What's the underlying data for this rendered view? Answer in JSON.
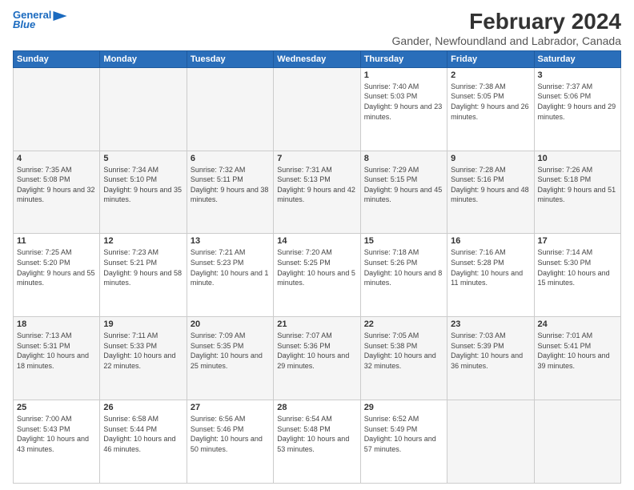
{
  "header": {
    "logo_line1": "General",
    "logo_line2": "Blue",
    "title": "February 2024",
    "subtitle": "Gander, Newfoundland and Labrador, Canada"
  },
  "weekdays": [
    "Sunday",
    "Monday",
    "Tuesday",
    "Wednesday",
    "Thursday",
    "Friday",
    "Saturday"
  ],
  "weeks": [
    [
      {
        "day": "",
        "empty": true
      },
      {
        "day": "",
        "empty": true
      },
      {
        "day": "",
        "empty": true
      },
      {
        "day": "",
        "empty": true
      },
      {
        "day": "1",
        "sunrise": "7:40 AM",
        "sunset": "5:03 PM",
        "daylight": "9 hours and 23 minutes."
      },
      {
        "day": "2",
        "sunrise": "7:38 AM",
        "sunset": "5:05 PM",
        "daylight": "9 hours and 26 minutes."
      },
      {
        "day": "3",
        "sunrise": "7:37 AM",
        "sunset": "5:06 PM",
        "daylight": "9 hours and 29 minutes."
      }
    ],
    [
      {
        "day": "4",
        "sunrise": "7:35 AM",
        "sunset": "5:08 PM",
        "daylight": "9 hours and 32 minutes."
      },
      {
        "day": "5",
        "sunrise": "7:34 AM",
        "sunset": "5:10 PM",
        "daylight": "9 hours and 35 minutes."
      },
      {
        "day": "6",
        "sunrise": "7:32 AM",
        "sunset": "5:11 PM",
        "daylight": "9 hours and 38 minutes."
      },
      {
        "day": "7",
        "sunrise": "7:31 AM",
        "sunset": "5:13 PM",
        "daylight": "9 hours and 42 minutes."
      },
      {
        "day": "8",
        "sunrise": "7:29 AM",
        "sunset": "5:15 PM",
        "daylight": "9 hours and 45 minutes."
      },
      {
        "day": "9",
        "sunrise": "7:28 AM",
        "sunset": "5:16 PM",
        "daylight": "9 hours and 48 minutes."
      },
      {
        "day": "10",
        "sunrise": "7:26 AM",
        "sunset": "5:18 PM",
        "daylight": "9 hours and 51 minutes."
      }
    ],
    [
      {
        "day": "11",
        "sunrise": "7:25 AM",
        "sunset": "5:20 PM",
        "daylight": "9 hours and 55 minutes."
      },
      {
        "day": "12",
        "sunrise": "7:23 AM",
        "sunset": "5:21 PM",
        "daylight": "9 hours and 58 minutes."
      },
      {
        "day": "13",
        "sunrise": "7:21 AM",
        "sunset": "5:23 PM",
        "daylight": "10 hours and 1 minute."
      },
      {
        "day": "14",
        "sunrise": "7:20 AM",
        "sunset": "5:25 PM",
        "daylight": "10 hours and 5 minutes."
      },
      {
        "day": "15",
        "sunrise": "7:18 AM",
        "sunset": "5:26 PM",
        "daylight": "10 hours and 8 minutes."
      },
      {
        "day": "16",
        "sunrise": "7:16 AM",
        "sunset": "5:28 PM",
        "daylight": "10 hours and 11 minutes."
      },
      {
        "day": "17",
        "sunrise": "7:14 AM",
        "sunset": "5:30 PM",
        "daylight": "10 hours and 15 minutes."
      }
    ],
    [
      {
        "day": "18",
        "sunrise": "7:13 AM",
        "sunset": "5:31 PM",
        "daylight": "10 hours and 18 minutes."
      },
      {
        "day": "19",
        "sunrise": "7:11 AM",
        "sunset": "5:33 PM",
        "daylight": "10 hours and 22 minutes."
      },
      {
        "day": "20",
        "sunrise": "7:09 AM",
        "sunset": "5:35 PM",
        "daylight": "10 hours and 25 minutes."
      },
      {
        "day": "21",
        "sunrise": "7:07 AM",
        "sunset": "5:36 PM",
        "daylight": "10 hours and 29 minutes."
      },
      {
        "day": "22",
        "sunrise": "7:05 AM",
        "sunset": "5:38 PM",
        "daylight": "10 hours and 32 minutes."
      },
      {
        "day": "23",
        "sunrise": "7:03 AM",
        "sunset": "5:39 PM",
        "daylight": "10 hours and 36 minutes."
      },
      {
        "day": "24",
        "sunrise": "7:01 AM",
        "sunset": "5:41 PM",
        "daylight": "10 hours and 39 minutes."
      }
    ],
    [
      {
        "day": "25",
        "sunrise": "7:00 AM",
        "sunset": "5:43 PM",
        "daylight": "10 hours and 43 minutes."
      },
      {
        "day": "26",
        "sunrise": "6:58 AM",
        "sunset": "5:44 PM",
        "daylight": "10 hours and 46 minutes."
      },
      {
        "day": "27",
        "sunrise": "6:56 AM",
        "sunset": "5:46 PM",
        "daylight": "10 hours and 50 minutes."
      },
      {
        "day": "28",
        "sunrise": "6:54 AM",
        "sunset": "5:48 PM",
        "daylight": "10 hours and 53 minutes."
      },
      {
        "day": "29",
        "sunrise": "6:52 AM",
        "sunset": "5:49 PM",
        "daylight": "10 hours and 57 minutes."
      },
      {
        "day": "",
        "empty": true
      },
      {
        "day": "",
        "empty": true
      }
    ]
  ]
}
